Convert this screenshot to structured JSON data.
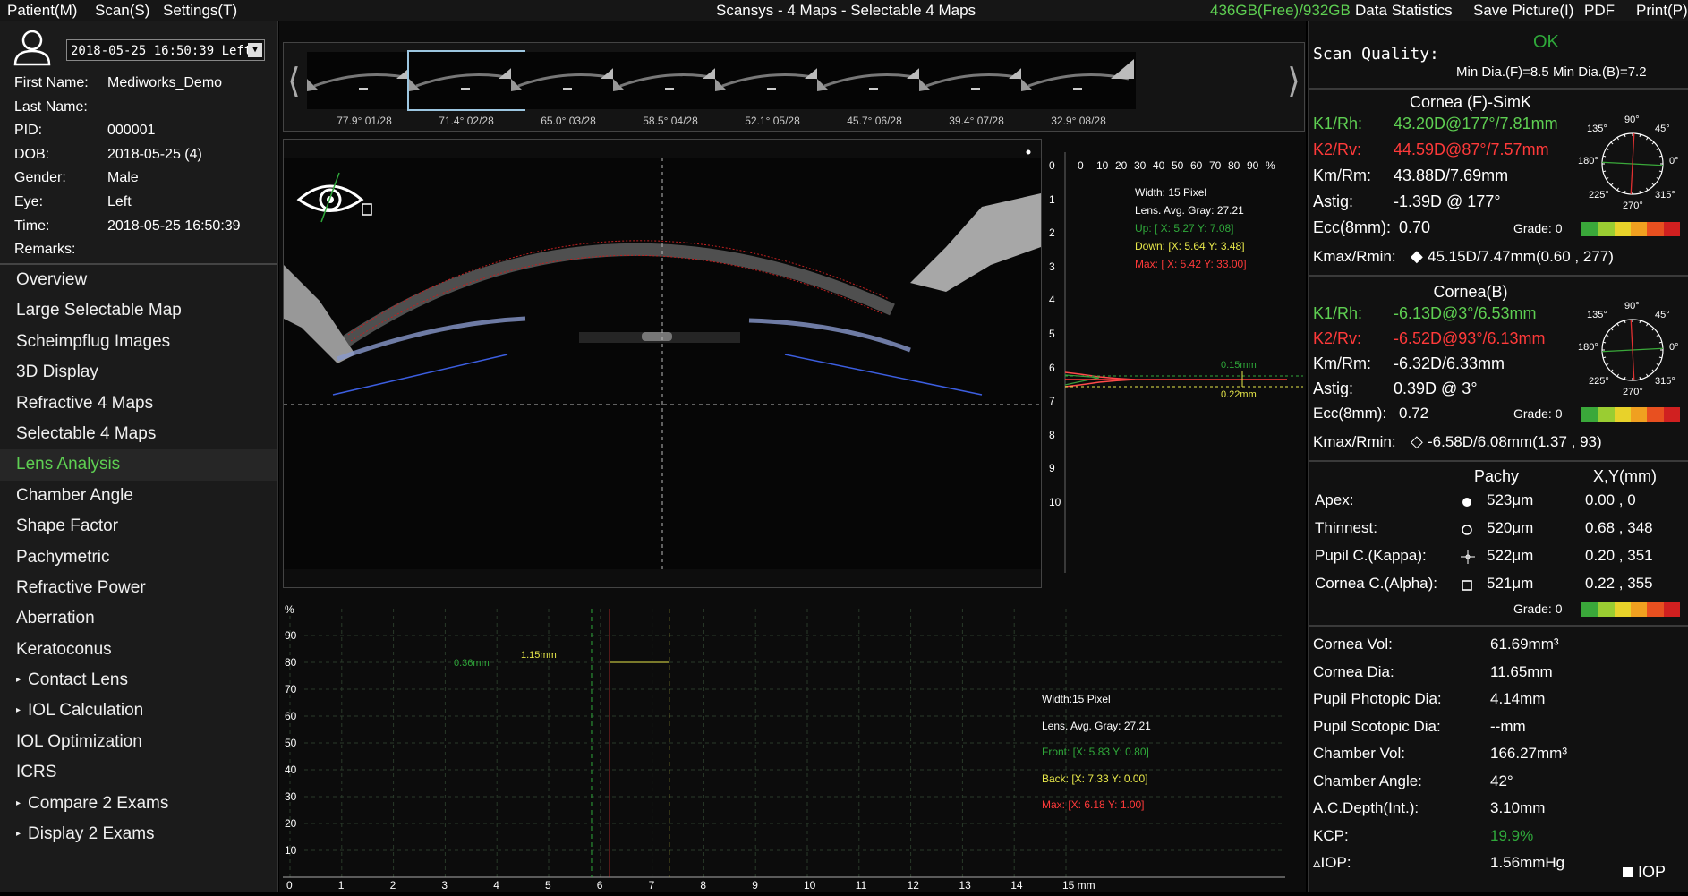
{
  "menu": {
    "patient": "Patient(M)",
    "scan": "Scan(S)",
    "settings": "Settings(T)",
    "title": "Scansys -  4 Maps - Selectable 4 Maps",
    "disk": "436GB(Free)/932GB",
    "data_statistics": "Data Statistics",
    "save_picture": "Save Picture(I)",
    "pdf": "PDF",
    "print": "Print(P)"
  },
  "patient": {
    "exam_selected": "2018-05-25 16:50:39 Left",
    "first_name_label": "First Name:",
    "first_name": "Mediworks_Demo",
    "last_name_label": "Last Name:",
    "last_name": "",
    "pid_label": "PID:",
    "pid": "000001",
    "dob_label": "DOB:",
    "dob": "2018-05-25  (4)",
    "gender_label": "Gender:",
    "gender": "Male",
    "eye_label": "Eye:",
    "eye": "Left",
    "time_label": "Time:",
    "time": "2018-05-25 16:50:39",
    "remarks_label": "Remarks:",
    "remarks": ""
  },
  "nav": [
    {
      "label": "Overview",
      "sub": false
    },
    {
      "label": "Large Selectable Map",
      "sub": false
    },
    {
      "label": "Scheimpflug Images",
      "sub": false
    },
    {
      "label": "3D Display",
      "sub": false
    },
    {
      "label": "Refractive 4 Maps",
      "sub": false
    },
    {
      "label": "Selectable 4 Maps",
      "sub": false
    },
    {
      "label": "Lens Analysis",
      "sub": false,
      "active": true
    },
    {
      "label": "Chamber Angle",
      "sub": false
    },
    {
      "label": "Shape Factor",
      "sub": false
    },
    {
      "label": "Pachymetric",
      "sub": false
    },
    {
      "label": "Refractive Power",
      "sub": false
    },
    {
      "label": "Aberration",
      "sub": false
    },
    {
      "label": "Keratoconus",
      "sub": false
    },
    {
      "label": "Contact Lens",
      "sub": true
    },
    {
      "label": "IOL Calculation",
      "sub": true
    },
    {
      "label": "IOL Optimization",
      "sub": false
    },
    {
      "label": "ICRS",
      "sub": false
    },
    {
      "label": "Compare 2 Exams",
      "sub": true
    },
    {
      "label": "Display 2 Exams",
      "sub": true
    }
  ],
  "thumbs": [
    "77.9°  01/28",
    "71.4°  02/28",
    "65.0°  03/28",
    "58.5°  04/28",
    "52.1°  05/28",
    "45.7°  06/28",
    "39.4°  07/28",
    "32.9°  08/28"
  ],
  "thumb_selected_index": 1,
  "profile": {
    "top_ticks": [
      "0",
      "10",
      "20",
      "30",
      "40",
      "50",
      "60",
      "70",
      "80",
      "90",
      "%"
    ],
    "left_ticks": [
      "0",
      "1",
      "2",
      "3",
      "4",
      "5",
      "6",
      "7",
      "8",
      "9",
      "10"
    ],
    "width": "Width: 15 Pixel",
    "avg_gray": "Lens. Avg. Gray: 27.21",
    "up": "Up: [ X: 5.27  Y: 7.08]",
    "down": "Down: [X: 5.64  Y: 3.48]",
    "max": "Max: [ X: 5.42  Y: 33.00]",
    "meas_top": "0.15mm",
    "meas_bottom": "0.22mm"
  },
  "lower_chart": {
    "y_unit": "%",
    "y_ticks": [
      "90",
      "80",
      "70",
      "60",
      "50",
      "40",
      "30",
      "20",
      "10"
    ],
    "x_ticks": [
      "0",
      "1",
      "2",
      "3",
      "4",
      "5",
      "6",
      "7",
      "8",
      "9",
      "10",
      "11",
      "12",
      "13",
      "14",
      "15 mm"
    ],
    "meas_left": "0.36mm",
    "meas_right": "1.15mm",
    "width": "Width:15 Pixel",
    "avg_gray": "Lens. Avg. Gray: 27.21",
    "front": "Front: [X: 5.83  Y: 0.80]",
    "back": "Back: [X: 7.33  Y: 0.00]",
    "max": "Max: [X: 6.18  Y: 1.00]"
  },
  "quality": {
    "label": "Scan Quality:",
    "status": "OK",
    "min_dia": "Min Dia.(F)=8.5  Min Dia.(B)=7.2"
  },
  "cornea_f": {
    "title": "Cornea (F)-SimK",
    "k1_label": "K1/Rh:",
    "k1": "43.20D@177°/7.81mm",
    "k2_label": "K2/Rv:",
    "k2": "44.59D@87°/7.57mm",
    "km_label": "Km/Rm:",
    "km": "43.88D/7.69mm",
    "astig_label": "Astig:",
    "astig": "-1.39D @ 177°",
    "ecc_label": "Ecc(8mm):",
    "ecc": "0.70",
    "grade": "Grade: 0",
    "kmax_label": "Kmax/Rmin:",
    "kmax": "45.15D/7.47mm(0.60 , 277)"
  },
  "cornea_b": {
    "title": "Cornea(B)",
    "k1_label": "K1/Rh:",
    "k1": "-6.13D@3°/6.53mm",
    "k2_label": "K2/Rv:",
    "k2": "-6.52D@93°/6.13mm",
    "km_label": "Km/Rm:",
    "km": "-6.32D/6.33mm",
    "astig_label": "Astig:",
    "astig": "0.39D @ 3°",
    "ecc_label": "Ecc(8mm):",
    "ecc": "0.72",
    "grade": "Grade: 0",
    "kmax_label": "Kmax/Rmin:",
    "kmax": "-6.58D/6.08mm(1.37 , 93)"
  },
  "compass_labels": {
    "a90": "90°",
    "a45": "45°",
    "a0": "0°",
    "a315": "315°",
    "a270": "270°",
    "a225": "225°",
    "a180": "180°",
    "a135": "135°"
  },
  "pachy": {
    "col1": "Pachy",
    "col2": "X,Y(mm)",
    "rows": [
      {
        "label": "Apex:",
        "value": "523μm",
        "xy": "0.00 , 0"
      },
      {
        "label": "Thinnest:",
        "value": "520μm",
        "xy": "0.68 , 348"
      },
      {
        "label": "Pupil C.(Kappa):",
        "value": "522μm",
        "xy": "0.20 , 351"
      },
      {
        "label": "Cornea C.(Alpha):",
        "value": "521μm",
        "xy": "0.22 , 355"
      }
    ],
    "grade": "Grade: 0"
  },
  "metrics": [
    {
      "label": "Cornea Vol:",
      "value": "61.69mm³"
    },
    {
      "label": "Cornea Dia:",
      "value": "11.65mm"
    },
    {
      "label": "Pupil Photopic Dia:",
      "value": "4.14mm"
    },
    {
      "label": "Pupil Scotopic Dia:",
      "value": "--mm"
    },
    {
      "label": "Chamber Vol:",
      "value": "166.27mm³"
    },
    {
      "label": "Chamber Angle:",
      "value": "42°"
    },
    {
      "label": "A.C.Depth(Int.):",
      "value": "3.10mm"
    },
    {
      "label": "KCP:",
      "value": "19.9%"
    },
    {
      "label": "▵IOP:",
      "value": "1.56mmHg"
    }
  ],
  "iop_label": "IOP",
  "colors": {
    "green": "#5ecf52",
    "red": "#ff3a3a",
    "yellow": "#e8e84a",
    "accent_green": "#2fa83a"
  }
}
